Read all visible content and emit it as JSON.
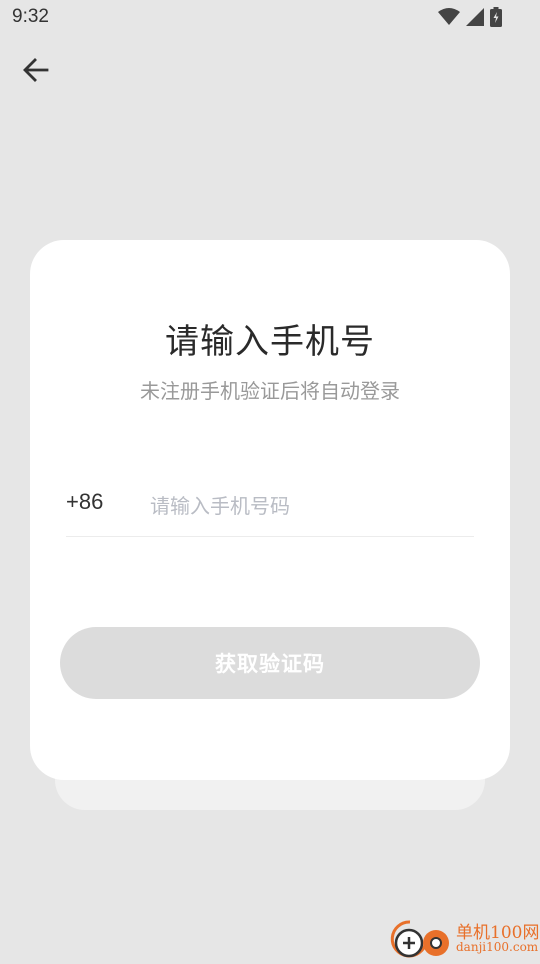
{
  "status_bar": {
    "time": "9:32"
  },
  "header": {
    "back_icon": "arrow-left-icon"
  },
  "login_card": {
    "title": "请输入手机号",
    "subtitle": "未注册手机验证后将自动登录",
    "country_code": "+86",
    "phone_value": "",
    "phone_placeholder": "请输入手机号码",
    "submit_label": "获取验证码"
  },
  "watermark": {
    "name": "单机100网",
    "url": "danji100.com"
  },
  "colors": {
    "background": "#e6e6e6",
    "card": "#ffffff",
    "button_disabled": "#dcdcdc",
    "placeholder": "#b9bcc4",
    "watermark": "#e8702a"
  }
}
